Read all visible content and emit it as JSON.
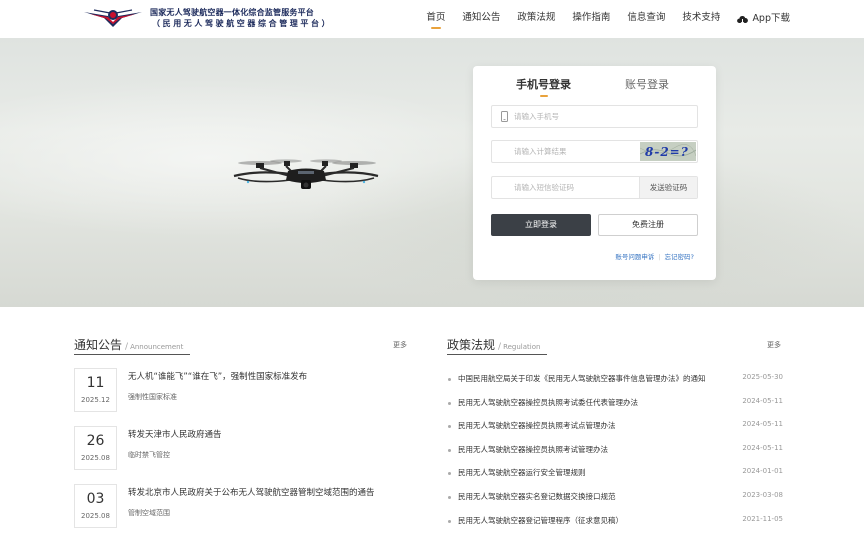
{
  "brand": {
    "line1": "国家无人驾驶航空器一体化综合监管服务平台",
    "line2": "（民用无人驾驶航空器综合管理平台）"
  },
  "nav": [
    {
      "label": "首页",
      "active": true
    },
    {
      "label": "通知公告"
    },
    {
      "label": "政策法规"
    },
    {
      "label": "操作指南"
    },
    {
      "label": "信息查询"
    },
    {
      "label": "技术支持"
    },
    {
      "label": "App下载"
    }
  ],
  "login": {
    "tab_phone": "手机号登录",
    "tab_account": "账号登录",
    "phone_placeholder": "请输入手机号",
    "calc_placeholder": "请输入计算结果",
    "captcha_text": "8-2=?",
    "sms_placeholder": "请输入短信验证码",
    "sms_button": "发送验证码",
    "login_button": "立即登录",
    "register_button": "免费注册",
    "link_appeal": "账号问题申诉",
    "link_forgot": "忘记密码?"
  },
  "notices": {
    "title": "通知公告",
    "subtitle": "Announcement",
    "more": "更多",
    "items": [
      {
        "day": "11",
        "ym": "2025.12",
        "title": "无人机“谁能飞”“谁在飞”，强制性国家标准发布",
        "tag": "强制性国家标准"
      },
      {
        "day": "26",
        "ym": "2025.08",
        "title": "转发天津市人民政府通告",
        "tag": "临时禁飞管控"
      },
      {
        "day": "03",
        "ym": "2025.08",
        "title": "转发北京市人民政府关于公布无人驾驶航空器管制空域范围的通告",
        "tag": "管制空域范围"
      }
    ]
  },
  "policies": {
    "title": "政策法规",
    "subtitle": "Regulation",
    "more": "更多",
    "items": [
      {
        "title": "中国民用航空局关于印发《民用无人驾驶航空器事件信息管理办法》的通知",
        "date": "2025-05-30"
      },
      {
        "title": "民用无人驾驶航空器操控员执照考试委任代表管理办法",
        "date": "2024-05-11"
      },
      {
        "title": "民用无人驾驶航空器操控员执照考试点管理办法",
        "date": "2024-05-11"
      },
      {
        "title": "民用无人驾驶航空器操控员执照考试管理办法",
        "date": "2024-05-11"
      },
      {
        "title": "民用无人驾驶航空器运行安全管理规则",
        "date": "2024-01-01"
      },
      {
        "title": "民用无人驾驶航空器实名登记数据交换接口规范",
        "date": "2023-03-08"
      },
      {
        "title": "民用无人驾驶航空器登记管理程序（征求意见稿）",
        "date": "2021-11-05"
      }
    ]
  },
  "colors": {
    "accent": "#e9a23b",
    "brand_navy": "#1d2b5c",
    "link": "#3473c2",
    "primary_button": "#3b4046"
  },
  "icons": [
    "caac-logo",
    "cloud-download-icon",
    "phone-icon",
    "drone-image"
  ]
}
